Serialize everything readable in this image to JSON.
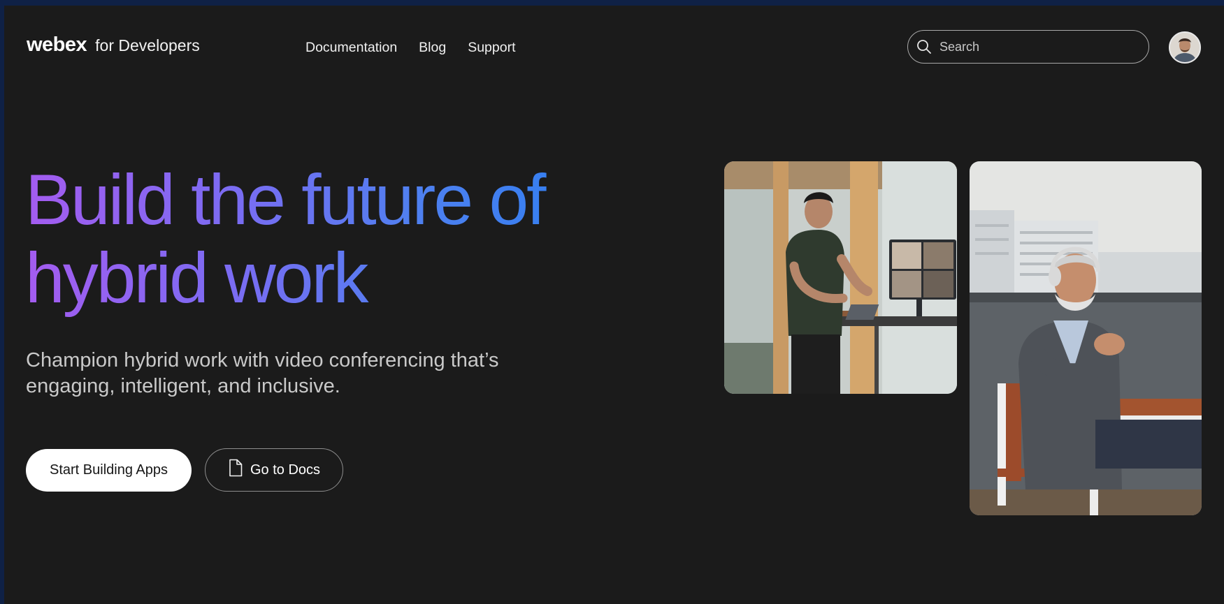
{
  "header": {
    "logo_mark": "webex",
    "logo_sub": "for Developers",
    "nav": [
      "Documentation",
      "Blog",
      "Support"
    ],
    "search_placeholder": "Search"
  },
  "hero": {
    "title": "Build the future of hybrid work",
    "subtitle_line1": "Champion hybrid work with video conferencing that’s",
    "subtitle_line2": "engaging, intelligent, and inclusive.",
    "primary_button": "Start Building Apps",
    "secondary_button": "Go to Docs"
  },
  "icons": {
    "search": "search-icon",
    "docs": "document-icon",
    "avatar": "user-avatar"
  },
  "colors": {
    "background": "#1b1b1b",
    "gradient_start": "#a45cf0",
    "gradient_end": "#2a7ef0"
  }
}
